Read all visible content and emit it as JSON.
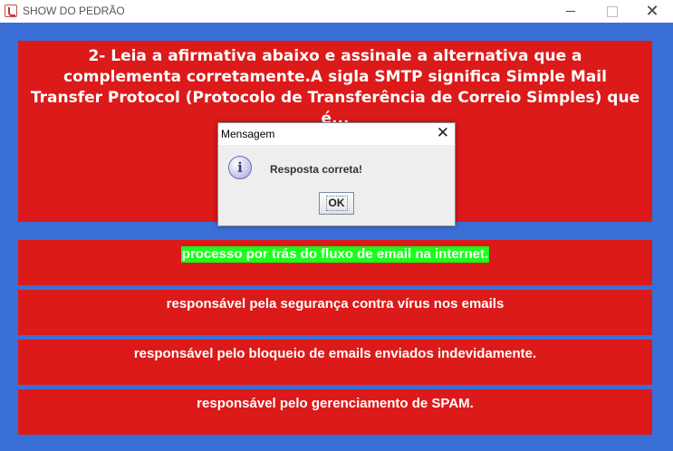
{
  "window": {
    "title": "SHOW DO PEDRÃO",
    "close_glyph": "✕"
  },
  "question": {
    "text": "2- Leia a afirmativa abaixo e assinale a alternativa que a complementa corretamente.A sigla SMTP significa Simple Mail Transfer Protocol (Protocolo de Transferência de Correio Simples) que é..."
  },
  "answers": [
    {
      "label": "processo por trás do fluxo de email na internet.",
      "highlighted": true,
      "highlight_color": "#1aff1a"
    },
    {
      "label": "responsável pela segurança contra vírus nos emails"
    },
    {
      "label": "responsável pelo bloqueio de emails enviados indevidamente."
    },
    {
      "label": "responsável pelo gerenciamento de SPAM."
    }
  ],
  "dialog": {
    "title": "Mensagem",
    "icon": "info-icon",
    "icon_glyph": "i",
    "message": "Resposta correta!",
    "ok_label": "OK",
    "close_glyph": "✕"
  },
  "colors": {
    "background": "#3a6fd8",
    "panel": "#dc1a1a",
    "text": "#ffffff",
    "correct_highlight": "#1aff1a"
  }
}
